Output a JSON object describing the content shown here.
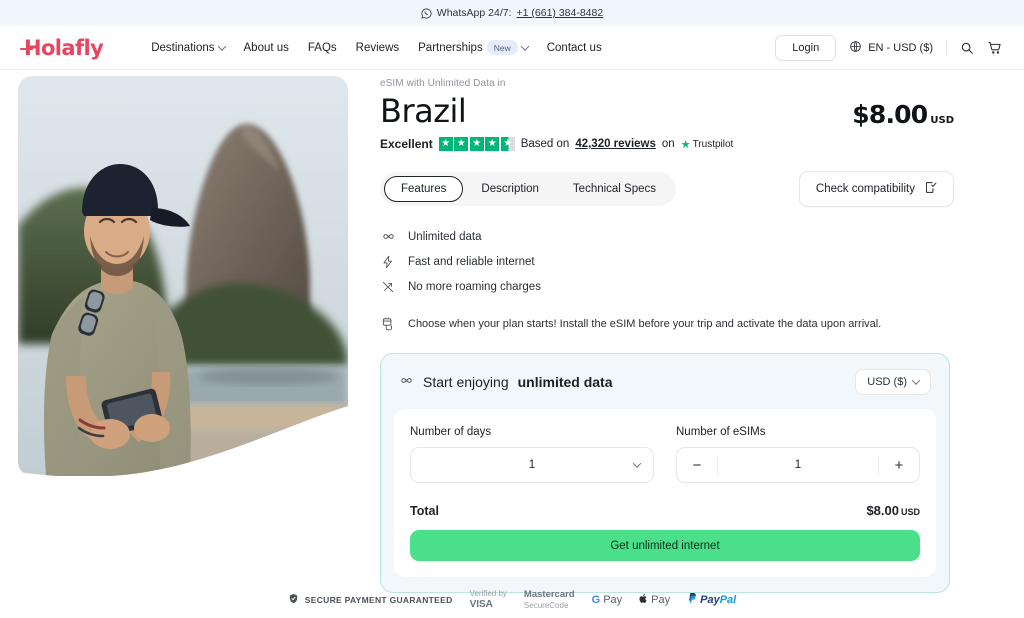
{
  "promo": {
    "icon": "whatsapp-icon",
    "text": "WhatsApp 24/7:",
    "phone": "+1 (661) 384-8482"
  },
  "header": {
    "logo": "Holafly",
    "nav": [
      {
        "label": "Destinations",
        "caret": true,
        "badge": null
      },
      {
        "label": "About us",
        "caret": false,
        "badge": null
      },
      {
        "label": "FAQs",
        "caret": false,
        "badge": null
      },
      {
        "label": "Reviews",
        "caret": false,
        "badge": null
      },
      {
        "label": "Partnerships",
        "caret": true,
        "badge": "New"
      },
      {
        "label": "Contact us",
        "caret": false,
        "badge": null
      }
    ],
    "login_label": "Login",
    "locale_label": "EN - USD ($)",
    "icons": [
      "globe-icon",
      "search-icon",
      "cart-icon"
    ]
  },
  "product": {
    "eyebrow": "eSIM with Unlimited Data in",
    "country": "Brazil",
    "price": "$8.00",
    "price_currency": "USD",
    "trustpilot": {
      "rating_label": "Excellent",
      "stars_full": 4,
      "stars_half": 1,
      "based_on": "Based on",
      "reviews": "42,320 reviews",
      "on_word": "on",
      "brand": "Trustpilot",
      "star_color": "#00b67a"
    },
    "tabs": [
      {
        "label": "Features",
        "active": true
      },
      {
        "label": "Description",
        "active": false
      },
      {
        "label": "Technical Specs",
        "active": false
      }
    ],
    "compatibility_label": "Check compatibility",
    "compatibility_icon": "device-check-icon",
    "features": [
      {
        "icon": "infinity-icon",
        "glyph": "∞",
        "label": "Unlimited data"
      },
      {
        "icon": "lightning-icon",
        "glyph": "⚡",
        "label": "Fast and reliable internet"
      },
      {
        "icon": "no-roaming-icon",
        "glyph": "⇗",
        "label": "No more roaming charges"
      }
    ],
    "note_icon": "calendar-hand-icon",
    "note": "Choose when your plan starts! Install the eSIM before your trip and activate the data upon arrival."
  },
  "buy_card": {
    "heading_prefix": "Start enjoying",
    "heading_bold": "unlimited data",
    "heading_icon": "infinity-icon",
    "currency_value": "USD ($)",
    "days_label": "Number of days",
    "days_value": "1",
    "esims_label": "Number of eSIMs",
    "esims_value": "1",
    "decrement": "−",
    "increment": "+",
    "total_label": "Total",
    "total_value": "$8.00",
    "total_currency": "USD",
    "cta_label": "Get unlimited internet",
    "accent_green": "#4ae08a",
    "border_color": "#b8e6dc",
    "header_bg": "#f2f7fb"
  },
  "payment_footer": {
    "secure_icon": "shield-check-icon",
    "secure_text": "SECURE PAYMENT GUARANTEED",
    "methods": [
      {
        "top": "Verified by",
        "bottom": "VISA"
      },
      {
        "top": "Mastercard",
        "bottom": "SecureCode"
      }
    ],
    "gpay": "Pay",
    "gpay_g": "G",
    "applepay": "Pay",
    "paypal_pay": "Pay",
    "paypal_pal": "Pal"
  },
  "hero": {
    "alt": "traveler-with-phone-sugarloaf-mountain"
  }
}
